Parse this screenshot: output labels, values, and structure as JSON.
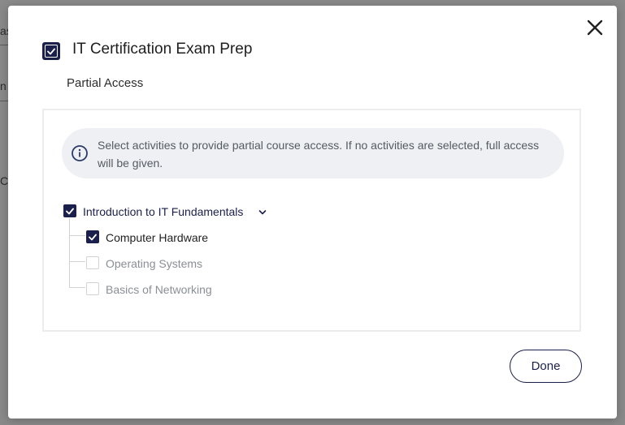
{
  "background": {
    "fragments": [
      "as",
      "n",
      "C"
    ]
  },
  "modal": {
    "title": "IT Certification Exam Prep",
    "title_checked": true,
    "subtitle": "Partial Access",
    "info": {
      "text": "Select activities to provide partial course access. If no activities are selected, full access will be given.",
      "icon": "info-icon"
    },
    "section": {
      "label": "Introduction to IT Fundamentals",
      "checked": true,
      "expanded": true,
      "items": [
        {
          "label": "Computer Hardware",
          "checked": true
        },
        {
          "label": "Operating Systems",
          "checked": false
        },
        {
          "label": "Basics of Networking",
          "checked": false
        }
      ]
    },
    "done_label": "Done",
    "close_icon": "close-icon"
  },
  "colors": {
    "accent": "#1b1f4b",
    "info_bg": "#eef0f3",
    "muted_text": "#8a8f96"
  }
}
